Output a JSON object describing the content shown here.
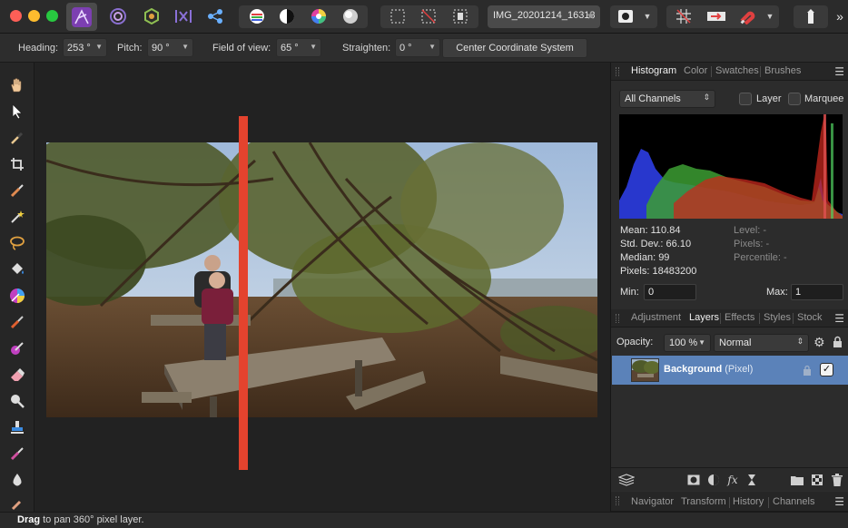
{
  "toolbar": {
    "document_tab": "IMG_20201214_16313",
    "star": "★"
  },
  "context_bar": {
    "heading_label": "Heading:",
    "heading_value": "253 °",
    "pitch_label": "Pitch:",
    "pitch_value": "90 °",
    "fov_label": "Field of view:",
    "fov_value": "65 °",
    "straighten_label": "Straighten:",
    "straighten_value": "0 °",
    "center_button": "Center Coordinate System"
  },
  "histogram_panel": {
    "tabs": [
      "Histogram",
      "Color",
      "Swatches",
      "Brushes"
    ],
    "active_tab": "Histogram",
    "channels": "All Channels",
    "layer_label": "Layer",
    "marquee_label": "Marquee",
    "stats": {
      "mean": "Mean: 110.84",
      "std_dev": "Std. Dev.: 66.10",
      "median": "Median: 99",
      "pixels": "Pixels: 18483200",
      "level": "Level: -",
      "pixels_sel": "Pixels: -",
      "percentile": "Percentile: -"
    },
    "min_label": "Min:",
    "min_value": "0",
    "max_label": "Max:",
    "max_value": "1"
  },
  "layers_panel": {
    "tabs": [
      "Adjustment",
      "Layers",
      "Effects",
      "Styles",
      "Stock"
    ],
    "active_tab": "Layers",
    "opacity_label": "Opacity:",
    "opacity_value": "100 %",
    "blend_mode": "Normal",
    "layer_name": "Background",
    "layer_type": "(Pixel)",
    "fx_label": "fx"
  },
  "bottom_panel": {
    "tabs": [
      "Navigator",
      "Transform",
      "History",
      "Channels"
    ]
  },
  "status": {
    "bold": "Drag",
    "text": " to pan 360° pixel layer."
  },
  "colors": {
    "splitter": "#e4432e",
    "layer_selected": "#5b82b9",
    "app_icon": "#7c3fb1"
  }
}
